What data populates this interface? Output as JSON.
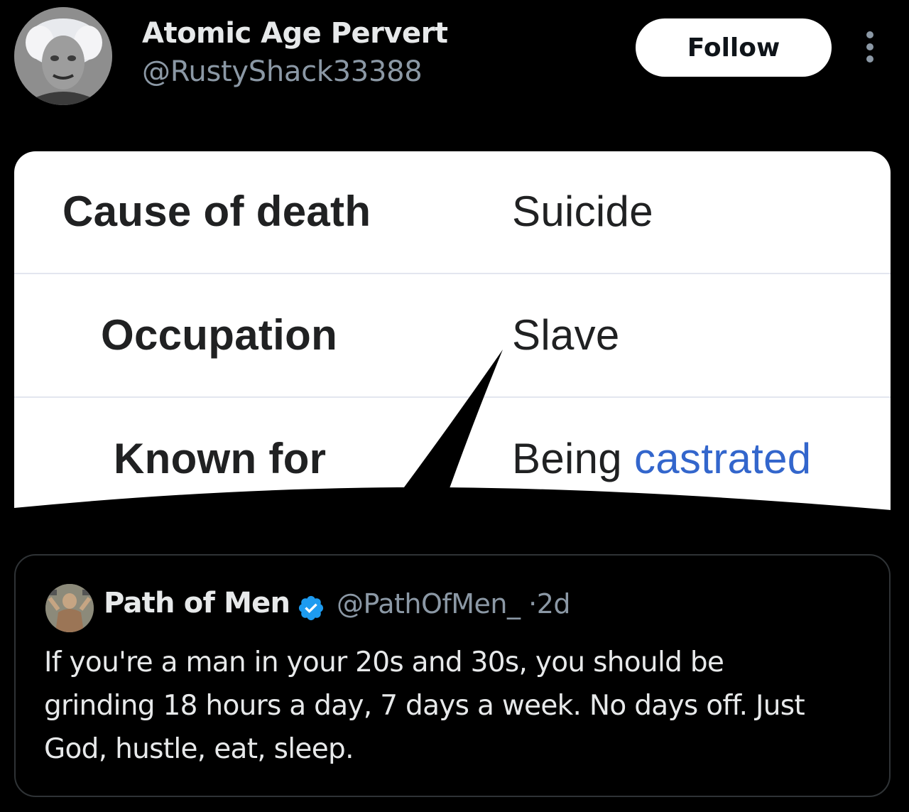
{
  "author": {
    "display_name": "Atomic Age Pervert",
    "handle": "@RustyShack33388",
    "avatar_icon": "avatar-image"
  },
  "actions": {
    "follow_label": "Follow",
    "more_icon": "more-options-icon"
  },
  "infobox": {
    "rows": [
      {
        "label": "Cause of death",
        "value": "Suicide",
        "value_is_link": true
      },
      {
        "label": "Occupation",
        "value": "Slave",
        "value_is_link": false
      },
      {
        "label": "Known for",
        "value_plain": "Being",
        "value_link": "castrated"
      }
    ],
    "link_color": "#3366cc"
  },
  "quoted_tweet": {
    "display_name": "Path of Men",
    "verified_icon": "verified-badge-icon",
    "handle": "@PathOfMen_",
    "separator": "·",
    "time": "2d",
    "text_lines": [
      "If you're a man in your 20s and 30s, you should be",
      "grinding 18 hours a day, 7 days a week. No days off. Just",
      "God, hustle, eat, sleep."
    ]
  },
  "colors": {
    "background": "#000000",
    "primary_text": "#e7e9ea",
    "secondary_text": "#8b98a5",
    "verified_blue": "#1d9bf0",
    "border": "#2f3336"
  }
}
